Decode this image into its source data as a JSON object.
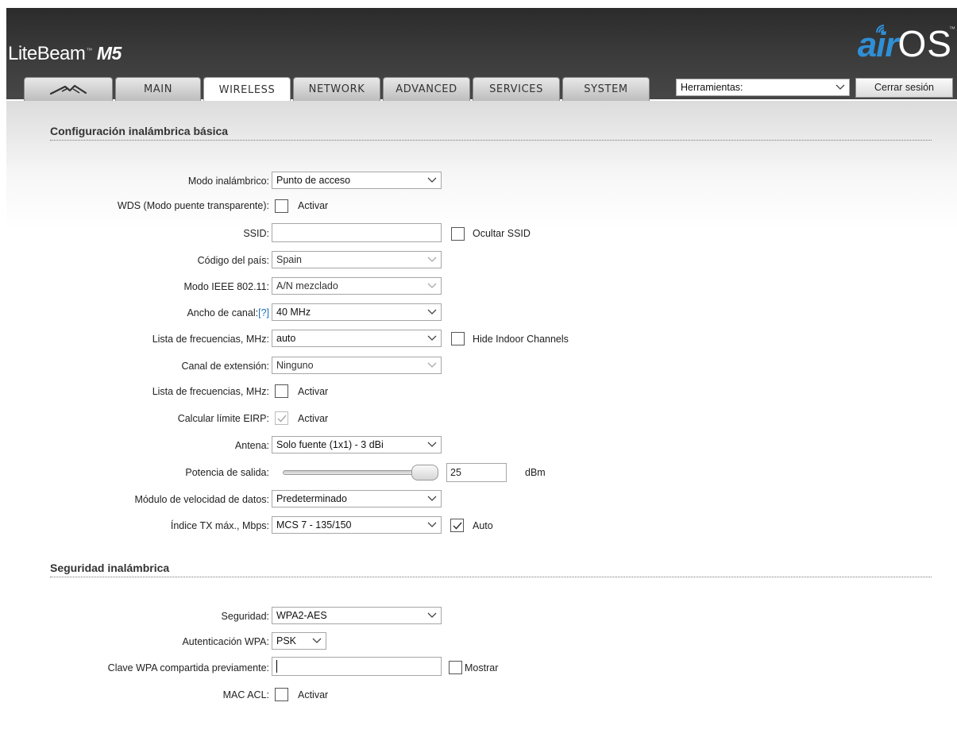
{
  "brand": {
    "name": "LiteBeam",
    "tm": "™",
    "model": "M5"
  },
  "logo": {
    "air": "air",
    "os": "OS",
    "tm": "™"
  },
  "nav": {
    "tabs": [
      "MAIN",
      "WIRELESS",
      "NETWORK",
      "ADVANCED",
      "SERVICES",
      "SYSTEM"
    ],
    "active": "WIRELESS",
    "tools_value": "Herramientas:",
    "logout_label": "Cerrar sesión"
  },
  "basic": {
    "title": "Configuración inalámbrica básica",
    "wireless_mode": {
      "label": "Modo inalámbrico:",
      "value": "Punto de acceso"
    },
    "wds": {
      "label": "WDS (Modo puente transparente):",
      "checkbox": "Activar",
      "checked": false
    },
    "ssid": {
      "label": "SSID:",
      "value": "",
      "hide_label": "Ocultar SSID",
      "hide_checked": false
    },
    "country": {
      "label": "Código del país:",
      "value": "Spain"
    },
    "ieee_mode": {
      "label": "Modo IEEE 802.11:",
      "value": "A/N mezclado"
    },
    "channel_width": {
      "label": "Ancho de canal:",
      "help": "[?]",
      "value": "40 MHz"
    },
    "freq_list": {
      "label": "Lista de frecuencias, MHz:",
      "value": "auto",
      "indoor_label": "Hide Indoor Channels",
      "indoor_checked": false
    },
    "ext_channel": {
      "label": "Canal de extensión:",
      "value": "Ninguno"
    },
    "freq_list2": {
      "label": "Lista de frecuencias, MHz:",
      "checkbox": "Activar",
      "checked": false
    },
    "eirp": {
      "label": "Calcular límite EIRP:",
      "checkbox": "Activar",
      "checked": true
    },
    "antenna": {
      "label": "Antena:",
      "value": "Solo fuente (1x1) - 3 dBi"
    },
    "output_power": {
      "label": "Potencia de salida:",
      "value": "25",
      "unit": "dBm",
      "level": 1.0
    },
    "rate_module": {
      "label": "Módulo de velocidad de datos:",
      "value": "Predeterminado"
    },
    "max_tx": {
      "label": "Índice TX máx., Mbps:",
      "value": "MCS 7 - 135/150",
      "auto_label": "Auto",
      "auto_checked": true
    }
  },
  "security": {
    "title": "Seguridad inalámbrica",
    "security": {
      "label": "Seguridad:",
      "value": "WPA2-AES"
    },
    "wpa_auth": {
      "label": "Autenticación WPA:",
      "value": "PSK"
    },
    "psk": {
      "label": "Clave WPA compartida previamente:",
      "value": "",
      "show_label": "Mostrar",
      "show_checked": false
    },
    "mac_acl": {
      "label": "MAC ACL:",
      "checkbox": "Activar",
      "checked": false
    }
  },
  "colors": {
    "header": "#3a3a3a",
    "logo_blue": "#2f8fd6",
    "link": "#1a6fc0"
  },
  "icons": {
    "ubnt_logo": "ubiquiti-logo-icon",
    "dropdown": "chevron-down-icon",
    "check": "check-icon"
  }
}
